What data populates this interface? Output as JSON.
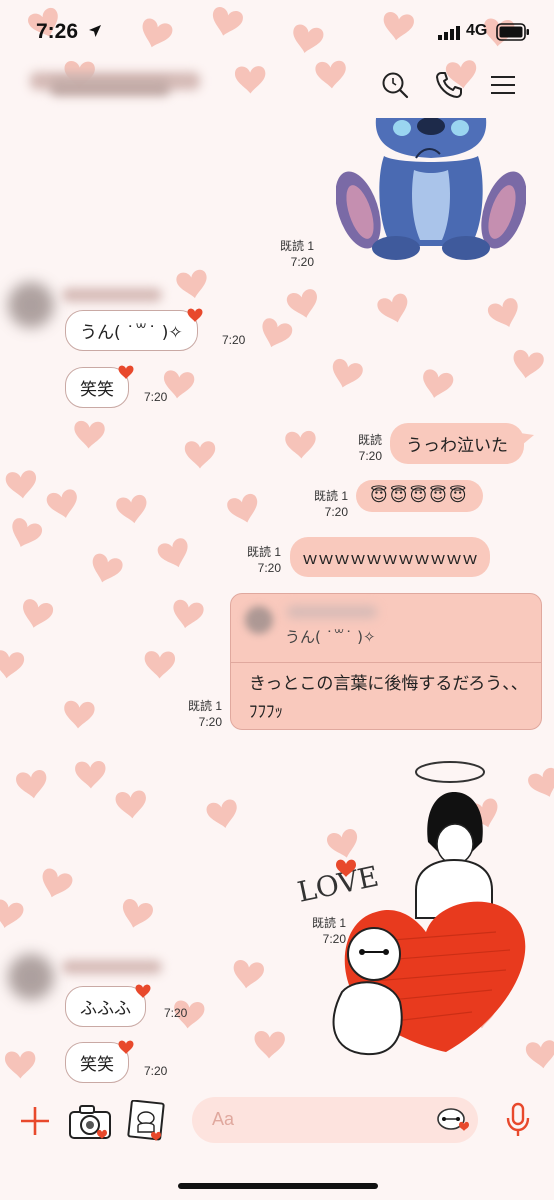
{
  "status_bar": {
    "time": "7:26",
    "network": "4G"
  },
  "header": {
    "icons": [
      "search-icon",
      "phone-icon",
      "menu-icon"
    ]
  },
  "messages": [
    {
      "id": "m1",
      "side": "out",
      "type": "sticker",
      "sticker": "stitch-crying-sticker",
      "read": "既読 1",
      "time": "7:20"
    },
    {
      "id": "m2",
      "side": "in",
      "type": "text",
      "text": "うん( ˙꒳˙ )✧",
      "time": "7:20"
    },
    {
      "id": "m3",
      "side": "in",
      "type": "text",
      "text": "笑笑",
      "time": "7:20"
    },
    {
      "id": "m4",
      "side": "out",
      "type": "text",
      "text": "うっわ泣いた",
      "read": "既読",
      "time": "7:20"
    },
    {
      "id": "m5",
      "side": "out",
      "type": "text",
      "text": "😇😇😇😇😇",
      "read": "既読 1",
      "time": "7:20"
    },
    {
      "id": "m6",
      "side": "out",
      "type": "text",
      "text": "ｗｗｗｗｗｗｗｗｗｗｗ",
      "read": "既読 1",
      "time": "7:20"
    },
    {
      "id": "m7",
      "side": "out",
      "type": "reply",
      "quote": "うん( ˙꒳˙ )✧",
      "text": "きっとこの言葉に後悔するだろう、、ﾌﾌﾌｯ",
      "read": "既読 1",
      "time": "7:20"
    },
    {
      "id": "m8",
      "side": "out",
      "type": "sticker",
      "sticker": "love-heart-sticker",
      "sticker_text": "LOVE",
      "read": "既読 1",
      "time": "7:20"
    },
    {
      "id": "m9",
      "side": "in",
      "type": "text",
      "text": "ふふふ",
      "time": "7:20"
    },
    {
      "id": "m10",
      "side": "in",
      "type": "text",
      "text": "笑笑",
      "time": "7:20"
    }
  ],
  "input": {
    "placeholder": "Aa"
  },
  "theme": {
    "background": "#fdf5f4",
    "outgoing_bubble": "#f9c9bd",
    "accent": "#e8492c",
    "heart": "#f0a598"
  }
}
